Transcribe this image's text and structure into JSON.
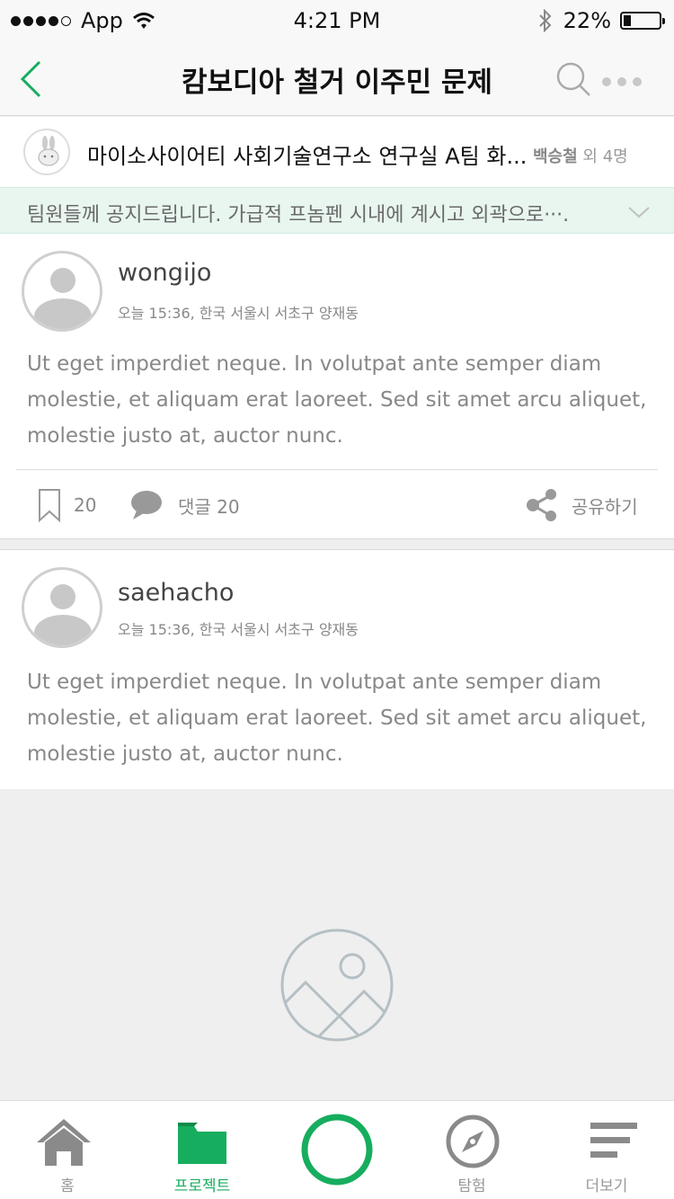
{
  "status": {
    "carrier": "App",
    "time": "4:21 PM",
    "battery": "22%",
    "battery_level": 0.22
  },
  "nav": {
    "title": "캄보디아 철거 이주민 문제"
  },
  "group": {
    "name": "마이소사이어티 사회기술연구소 연구실 A팀 화...",
    "leader": "백승철",
    "others": "외 4명"
  },
  "notice": {
    "text": "팀원들께 공지드립니다. 가급적 프놈펜 시내에 계시고 외곽으로···."
  },
  "posts": [
    {
      "author": "wongijo",
      "meta": "오늘 15:36, 한국 서울시 서초구 양재동",
      "body": "Ut eget imperdiet neque. In volutpat ante semper diam molestie, et aliquam erat laoreet. Sed sit amet arcu aliquet, molestie justo at, auctor nunc.",
      "bookmarks": "20",
      "comments": "댓글 20",
      "share": "공유하기"
    },
    {
      "author": "saehacho",
      "meta": "오늘 15:36, 한국 서울시 서초구 양재동",
      "body": "Ut eget imperdiet neque. In volutpat ante semper diam molestie, et aliquam erat laoreet. Sed sit amet arcu aliquet, molestie justo at, auctor nunc."
    }
  ],
  "tabs": [
    {
      "label": "홈",
      "icon": "home-icon",
      "active": false
    },
    {
      "label": "프로젝트",
      "icon": "folder-icon",
      "active": true
    },
    {
      "label": "",
      "icon": "create-circle-icon",
      "active": false
    },
    {
      "label": "탐험",
      "icon": "compass-icon",
      "active": false
    },
    {
      "label": "더보기",
      "icon": "menu-icon",
      "active": false
    }
  ],
  "colors": {
    "accent": "#16ad5f",
    "notice_bg": "#e8f6ef",
    "gray_icon": "#8a8a8a"
  }
}
